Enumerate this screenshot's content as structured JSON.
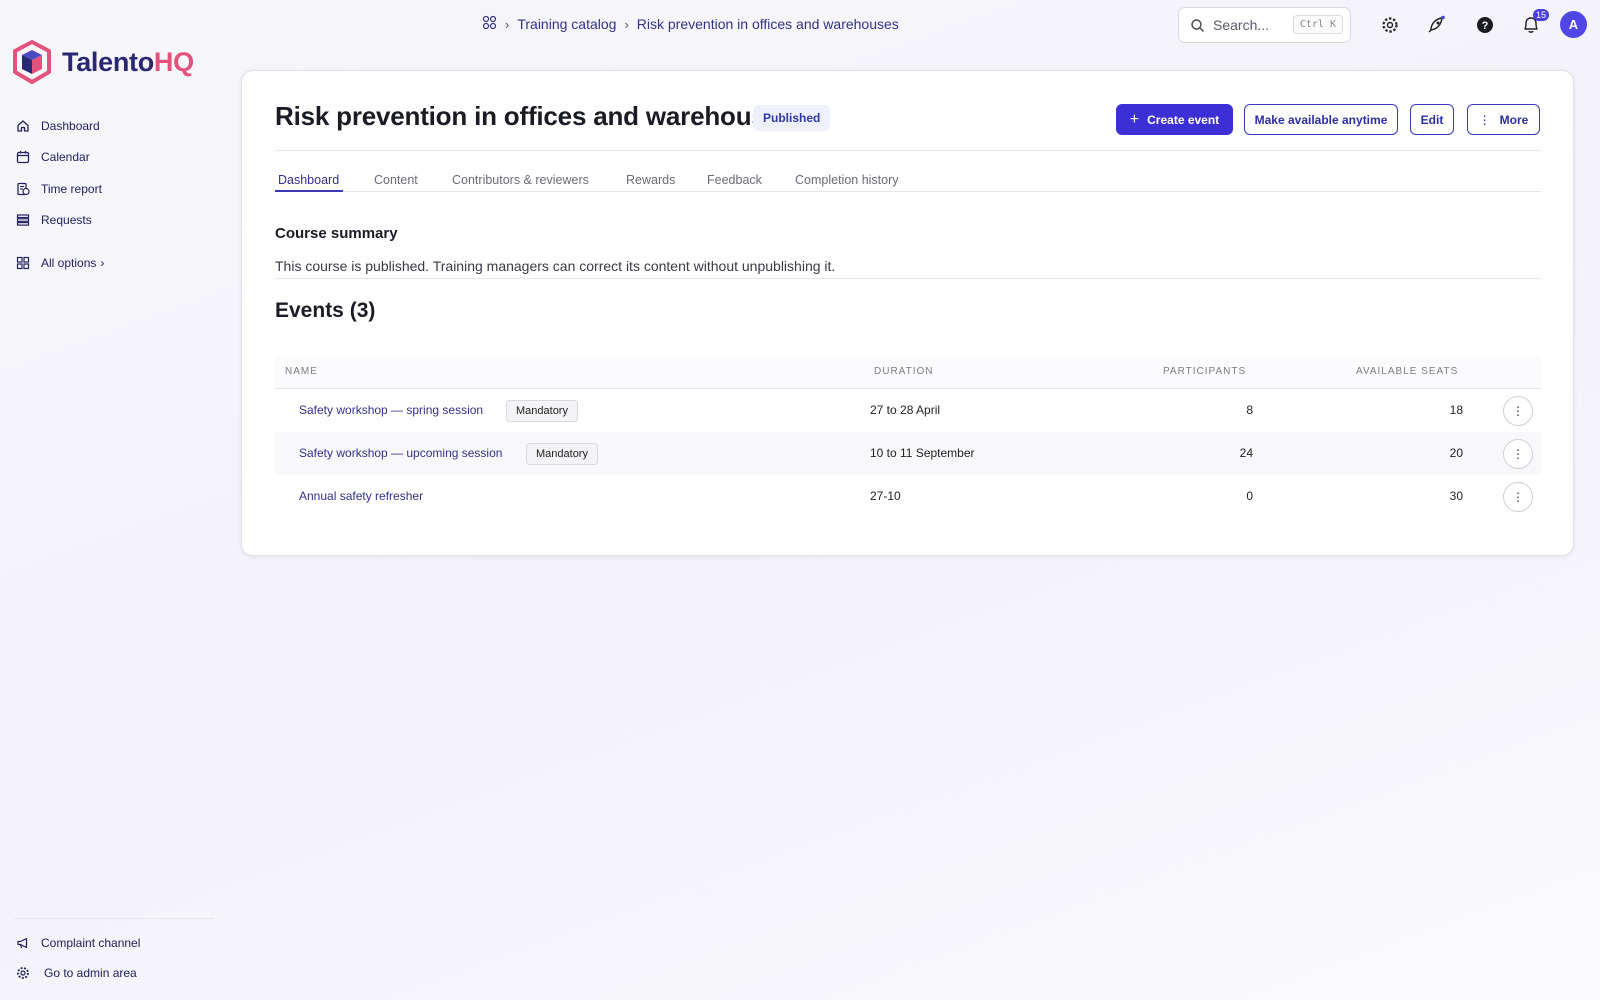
{
  "brand": {
    "name_part1": "Talento",
    "name_part2": "HQ",
    "primary_color": "#2a2872",
    "accent_color": "#e2527d"
  },
  "sidebar": {
    "items": [
      {
        "label": "Dashboard",
        "icon": "home-icon"
      },
      {
        "label": "Calendar",
        "icon": "calendar-icon"
      },
      {
        "label": "Time report",
        "icon": "clock-report-icon"
      },
      {
        "label": "Requests",
        "icon": "list-icon"
      },
      {
        "label": "All options",
        "icon": "grid-icon",
        "suffix": "›"
      }
    ],
    "bottom": [
      {
        "label": "Complaint channel",
        "icon": "megaphone-icon"
      },
      {
        "label": "Go to admin area",
        "icon": "gear-icon"
      }
    ]
  },
  "topbar": {
    "breadcrumbs": [
      "Training catalog",
      "Risk prevention in offices and warehouses"
    ],
    "search": {
      "placeholder": "Search...",
      "shortcut": "Ctrl K"
    },
    "notifications_count": "15",
    "avatar_initial": "A"
  },
  "course": {
    "title": "Risk prevention in offices and warehouses",
    "status": "Published",
    "actions": {
      "create_event": "Create event",
      "make_available": "Make available anytime",
      "edit": "Edit",
      "more": "More"
    },
    "tabs": [
      "Dashboard",
      "Content",
      "Contributors & reviewers",
      "Rewards",
      "Feedback",
      "Completion history"
    ],
    "active_tab": "Dashboard",
    "summary": {
      "title": "Course summary",
      "text": "This course is published. Training managers can correct its content without unpublishing it."
    },
    "events": {
      "title": "Events (3)",
      "columns": {
        "name": "NAME",
        "duration": "DURATION",
        "participants": "PARTICIPANTS",
        "available_seats": "AVAILABLE SEATS"
      },
      "rows": [
        {
          "name": "Safety workshop — spring session",
          "tag": "Mandatory",
          "duration": "27 to 28 April",
          "participants": "8",
          "seats": "18"
        },
        {
          "name": "Safety workshop — upcoming session",
          "tag": "Mandatory",
          "duration": "10 to 11 September",
          "participants": "24",
          "seats": "20"
        },
        {
          "name": "Annual safety refresher",
          "tag": "",
          "duration": "27-10",
          "participants": "0",
          "seats": "30"
        }
      ]
    }
  }
}
